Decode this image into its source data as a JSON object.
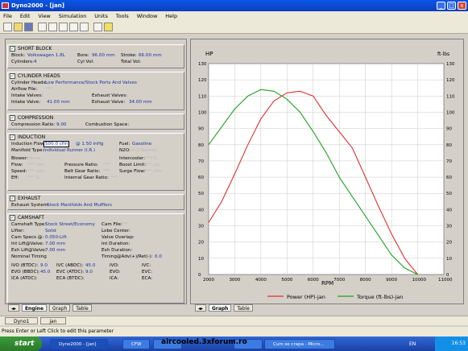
{
  "window": {
    "title": "Dyno2000 - [jan]",
    "controls": [
      "_",
      "□",
      "x"
    ]
  },
  "menu": [
    "File",
    "Edit",
    "View",
    "Simulation",
    "Units",
    "Tools",
    "Window",
    "Help"
  ],
  "toolbar": {
    "icons": [
      "new-icon",
      "open-icon",
      "save-icon",
      "tool-icon",
      "tool-icon",
      "tool-icon",
      "tool-icon",
      "tool-icon",
      "print-icon",
      "help-icon"
    ]
  },
  "short_block": {
    "header": "SHORT BLOCK",
    "block_label": "Block:",
    "block_value": "Volkswagen 1.8L",
    "bore_label": "Bore:",
    "bore_value": "96.00 mm",
    "stroke_label": "Stroke:",
    "stroke_value": "66.00 mm",
    "cylinders_label": "Cylinders:",
    "cylinders_value": "4",
    "cylvol_label": "Cyl Vol:",
    "totalvol_label": "Total Vol:"
  },
  "cylinder_heads": {
    "header": "CYLINDER HEADS",
    "heads_label": "Cylinder Heads:",
    "heads_value": "Low Performance/Stock Ports And Valves",
    "airflow_label": "Airflow File:",
    "airflow_value": "***",
    "intake_valves_label": "Intake Valves:",
    "exhaust_valves_label": "Exhaust Valves:",
    "intake_valve_label": "Intake Valve:",
    "intake_valve_value": "41.00 mm",
    "exhaust_valve_label": "Exhaust Valve:",
    "exhaust_valve_value": "34.00 mm"
  },
  "compression": {
    "header": "COMPRESSION",
    "ratio_label": "Compression Ratio:",
    "ratio_value": "9.00",
    "space_label": "Combustion Space:"
  },
  "induction": {
    "header": "INDUCTION",
    "flow_label": "Induction Flow:",
    "flow_value": "500.0 cfm",
    "flow_at": "@ 1.50 inHg",
    "fuel_label": "Fuel:",
    "fuel_value": "Gasoline",
    "manifold_label": "Manifold Type:",
    "manifold_value": "Individual Runner (I.R.)",
    "n2o_label": "N2O:",
    "n2o_value": "0.0 lbs/min",
    "blower_label": "Blower:",
    "blower_value": "None",
    "intercooler_label": "Intercooler:",
    "intercooler_value": "*** %",
    "flow2_label": "Flow:",
    "flow2_value": "*** cfm",
    "pressure_label": "Pressure Ratio:",
    "pressure_value": "***",
    "boost_label": "Boost Limit:",
    "boost_value": "*** psi",
    "speed_label": "Speed:",
    "speed_value": "*** rpm",
    "beltgear_label": "Belt Gear Ratio:",
    "beltgear_value": "***",
    "surge_label": "Surge Flow:",
    "surge_value": "*** cfm",
    "eff_label": "Eff:",
    "eff_value": "*** %",
    "internal_label": "Internal Gear Ratio:",
    "internal_value": "***"
  },
  "exhaust": {
    "header": "EXHAUST",
    "system_label": "Exhaust System:",
    "system_value": "Stock Manifolds And Mufflers"
  },
  "camshaft": {
    "header": "CAMSHAFT",
    "type_label": "Camshaft Type:",
    "type_value": "Stock Street/Economy",
    "camfile_label": "Cam File:",
    "camfile_value": "***",
    "lifter_label": "Lifter:",
    "lifter_value": "Solid",
    "lobe_label": "Lobe Center:",
    "specs_label": "Cam Specs @:",
    "specs_value": "0.050-Lift",
    "overlap_label": "Valve Overlap:",
    "intlift_label": "Int Lift@Valve:",
    "intlift_value": "7.00 mm",
    "intdur_label": "Int Duration:",
    "exhlift_label": "Exh Lift@Valve:",
    "exhlift_value": "7.00 mm",
    "exhdur_label": "Exh Duration:",
    "nominal_label": "Nominal Timing",
    "timing_label": "Timing@Adv(+)/Ret(-):",
    "timing_value": "0.0",
    "ivo_label": "IVO (BTDC):",
    "ivo_value": "9.0",
    "ivc_label": "IVC (ABDC):",
    "ivc_value": "45.0",
    "ivo2_label": "IVO:",
    "ivc2_label": "IVC:",
    "evo_label": "EVO (BBDC):",
    "evo_value": "45.0",
    "evc_label": "EVC (ATDC):",
    "evc_value": "9.0",
    "evo2_label": "EVO:",
    "evc2_label": "EVC:",
    "ica_label": "ICA (ATDC):",
    "eca_label": "ECA (BTDC):",
    "ica2_label": "ICA:",
    "eca2_label": "ECA:"
  },
  "left_tabs": [
    "Engine",
    "Graph",
    "Table"
  ],
  "graph_tabs": [
    "Graph",
    "Table"
  ],
  "doc_tabs": [
    "Dyno1",
    "jan"
  ],
  "status_text": "Press Enter or Left Click to edit this parameter",
  "taskbar": {
    "start": "start",
    "tasks": [
      "CFW",
      "Dyno2000 - [jan]",
      "",
      "",
      "Cum se crapa - Micro..."
    ],
    "tray_lang": "EN",
    "clock": "16:53"
  },
  "watermark": "aircooled.3xforum.ro",
  "colors": {
    "power": "#e03030",
    "torque": "#20a020",
    "chart_bg": "#ffffff",
    "titlebar": "#0a56e6"
  },
  "chart_data": {
    "type": "line",
    "ylabel_left": "HP",
    "ylabel_right": "ft-lbs",
    "xlabel": "RPM",
    "xlim": [
      2000,
      11000
    ],
    "ylim": [
      0,
      130
    ],
    "x_ticks": [
      2000,
      3000,
      4000,
      5000,
      6000,
      7000,
      8000,
      9000,
      10000,
      11000
    ],
    "y_ticks": [
      0,
      10,
      20,
      30,
      40,
      50,
      60,
      70,
      80,
      90,
      100,
      110,
      120,
      130
    ],
    "grid": true,
    "legend_position": "bottom",
    "series": [
      {
        "name": "Power (HP)-jan",
        "x": [
          2000,
          2500,
          3000,
          3500,
          4000,
          4500,
          5000,
          5500,
          6000,
          6500,
          7000,
          7500,
          8000,
          8500,
          9000,
          9500,
          10000
        ],
        "values": [
          32,
          45,
          62,
          80,
          96,
          107,
          112,
          113,
          110,
          98,
          88,
          78,
          60,
          42,
          25,
          10,
          0
        ]
      },
      {
        "name": "Torque (ft-lbs)-jan",
        "x": [
          2000,
          2500,
          3000,
          3500,
          4000,
          4500,
          5000,
          5500,
          6000,
          6500,
          7000,
          7500,
          8000,
          8500,
          9000,
          9500,
          10000
        ],
        "values": [
          80,
          91,
          102,
          110,
          114,
          113,
          108,
          100,
          88,
          75,
          60,
          48,
          36,
          24,
          12,
          4,
          0
        ]
      }
    ]
  }
}
